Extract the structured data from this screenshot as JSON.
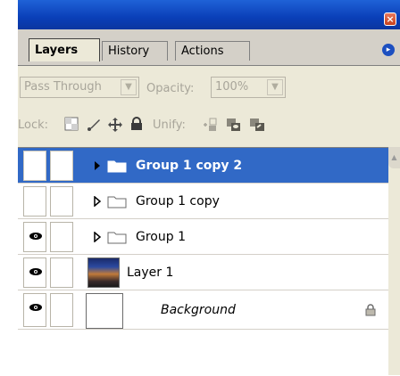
{
  "window": {
    "close_label": "×"
  },
  "tabs": [
    {
      "label": "Layers"
    },
    {
      "label": "History"
    },
    {
      "label": "Actions"
    }
  ],
  "panel_menu": {
    "icon": "panel-menu-arrow-icon",
    "glyph": "▸"
  },
  "blend": {
    "mode_value": "Pass Through",
    "opacity_label": "Opacity:",
    "opacity_value": "100%"
  },
  "lock": {
    "label": "Lock:",
    "unify_label": "Unify:"
  },
  "layers": [
    {
      "name": "Group 1 copy 2",
      "type": "group",
      "visible": false,
      "selected": true
    },
    {
      "name": "Group 1 copy",
      "type": "group",
      "visible": false,
      "selected": false
    },
    {
      "name": "Group 1",
      "type": "group",
      "visible": true,
      "selected": false
    },
    {
      "name": "Layer 1",
      "type": "image",
      "visible": true,
      "selected": false
    },
    {
      "name": "Background",
      "type": "background",
      "visible": true,
      "selected": false,
      "locked": true
    }
  ],
  "colors": {
    "selection": "#3169c6",
    "titlebar": "#0a3fb8",
    "panel_bg": "#ece9d8"
  }
}
